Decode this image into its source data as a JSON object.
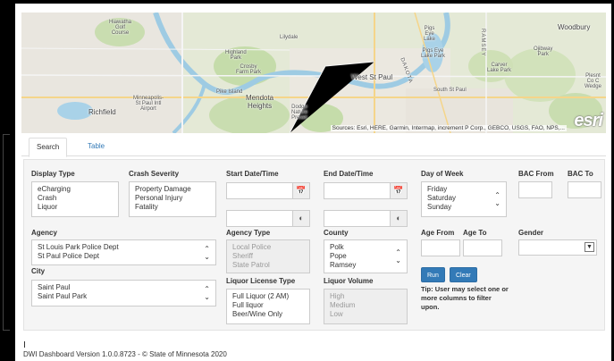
{
  "map": {
    "labels": {
      "hiawatha": "Hiawatha\nGolf\nCourse",
      "lilydale": "Lilydale",
      "highland": "Highland\nPark",
      "crosby": "Crosby\nFarm Park",
      "pike": "Pike Island",
      "mendota": "Mendota\nHeights",
      "minnesota": "Minneapolis-\nSt Paul Intl\nAirport",
      "richfield": "Richfield",
      "westStPaul": "West St Paul",
      "southStPaul": "South St Paul",
      "pigsEye": "Pigs\nEye\nLake",
      "pigsEyePark": "Pigs Eye\nLake Park",
      "carver": "Carver\nLake Park",
      "woodbury": "Woodbury",
      "ojibway": "Ojibway\nPark",
      "dodge": "Dodge\nNature\nPreser",
      "ramsey": "RAMSEY",
      "dakota": "DAKOTA",
      "pleasant": "Plesnt\nCo C\nWedge"
    },
    "attribution": "Sources: Esri, HERE, Garmin, Intermap, increment P Corp., GEBCO, USGS, FAO, NPS,...",
    "logo": "esri"
  },
  "tabs": [
    {
      "label": "Search",
      "active": true
    },
    {
      "label": "Table",
      "active": false
    }
  ],
  "filters": {
    "display_type": {
      "label": "Display Type",
      "options": [
        "eCharging",
        "Crash",
        "Liquor"
      ]
    },
    "crash_severity": {
      "label": "Crash Severity",
      "options": [
        "Property Damage",
        "Personal Injury",
        "Fatality"
      ]
    },
    "start_datetime": {
      "label": "Start Date/Time"
    },
    "end_datetime": {
      "label": "End Date/Time"
    },
    "day_of_week": {
      "label": "Day of Week",
      "options": [
        "Friday",
        "Saturday",
        "Sunday"
      ]
    },
    "bac_from": {
      "label": "BAC From"
    },
    "bac_to": {
      "label": "BAC To"
    },
    "agency": {
      "label": "Agency",
      "options": [
        "St Louis Park Police Dept",
        "St Paul Police Dept"
      ]
    },
    "agency_type": {
      "label": "Agency Type",
      "options": [
        "Local Police",
        "Sheriff",
        "State Patrol"
      ]
    },
    "county": {
      "label": "County",
      "options": [
        "Polk",
        "Pope",
        "Ramsey"
      ]
    },
    "age_from": {
      "label": "Age From"
    },
    "age_to": {
      "label": "Age To"
    },
    "gender": {
      "label": "Gender"
    },
    "city": {
      "label": "City",
      "options": [
        "Saint Paul",
        "Saint Paul Park"
      ]
    },
    "liquor_license_type": {
      "label": "Liquor License Type",
      "options": [
        "Full Liquor (2 AM)",
        "Full liquor",
        "Beer/Wine Only"
      ]
    },
    "liquor_volume": {
      "label": "Liquor Volume",
      "options": [
        "High",
        "Medium",
        "Low"
      ]
    }
  },
  "actions": {
    "run": "Run",
    "clear": "Clear"
  },
  "tip": "Tip: User may select one or more columns to filter upon.",
  "footer": "DWI Dashboard Version 1.0.0.8723 - © State of Minnesota 2020",
  "icons": {
    "calendar": "calendar-icon",
    "clock": "clock-icon"
  }
}
